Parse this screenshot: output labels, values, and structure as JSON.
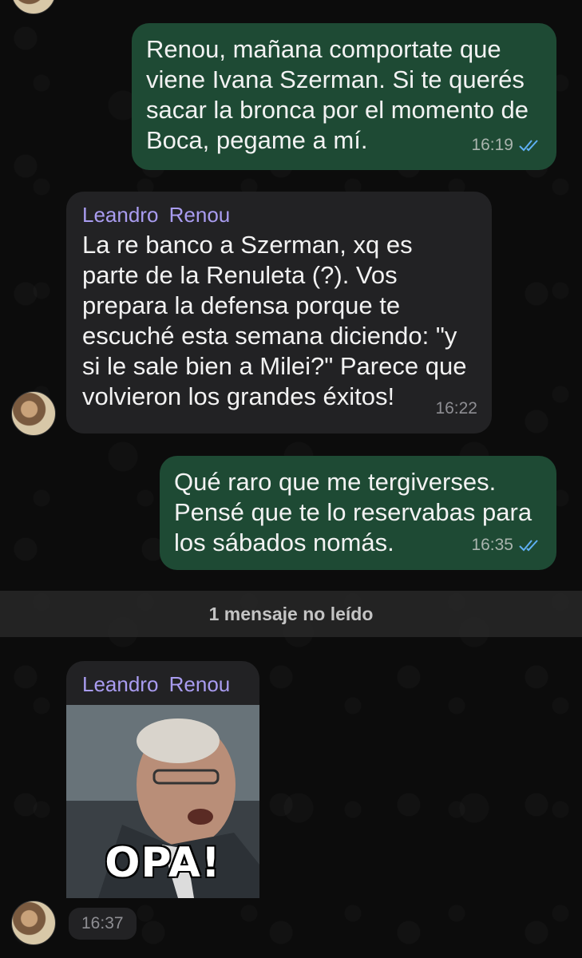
{
  "messages": [
    {
      "id": "m1",
      "direction": "out",
      "text": "Renou, mañana comportate que\nviene Ivana Szerman. Si te querés\nsacar la bronca por el momento de\nBoca, pegame a mí.",
      "time": "16:19",
      "status_icon": "double-check-read-icon"
    },
    {
      "id": "m2",
      "direction": "in",
      "sender": "Leandro  Renou",
      "text": "La re banco a Szerman, xq es\nparte de la Renuleta (?). Vos\nprepara la defensa porque te\nescuché esta semana diciendo: \"y\nsi le sale bien a Milei?\" Parece que\nvolvieron los grandes éxitos!",
      "time": "16:22"
    },
    {
      "id": "m3",
      "direction": "out",
      "text": "Qué raro que me tergiverses.\nPensé que te lo reservabas para\nlos sábados nomás.",
      "time": "16:35",
      "status_icon": "double-check-read-icon"
    },
    {
      "id": "m4",
      "direction": "in",
      "sender": "Leandro  Renou",
      "gif_caption": "OPA!",
      "time": "16:37"
    }
  ],
  "unread_divider": "1 mensaje no leído",
  "colors": {
    "outgoing_bubble": "#1e4a34",
    "incoming_bubble": "#222224",
    "sender_name": "#a99cf0",
    "read_ticks": "#5fb0f5"
  }
}
